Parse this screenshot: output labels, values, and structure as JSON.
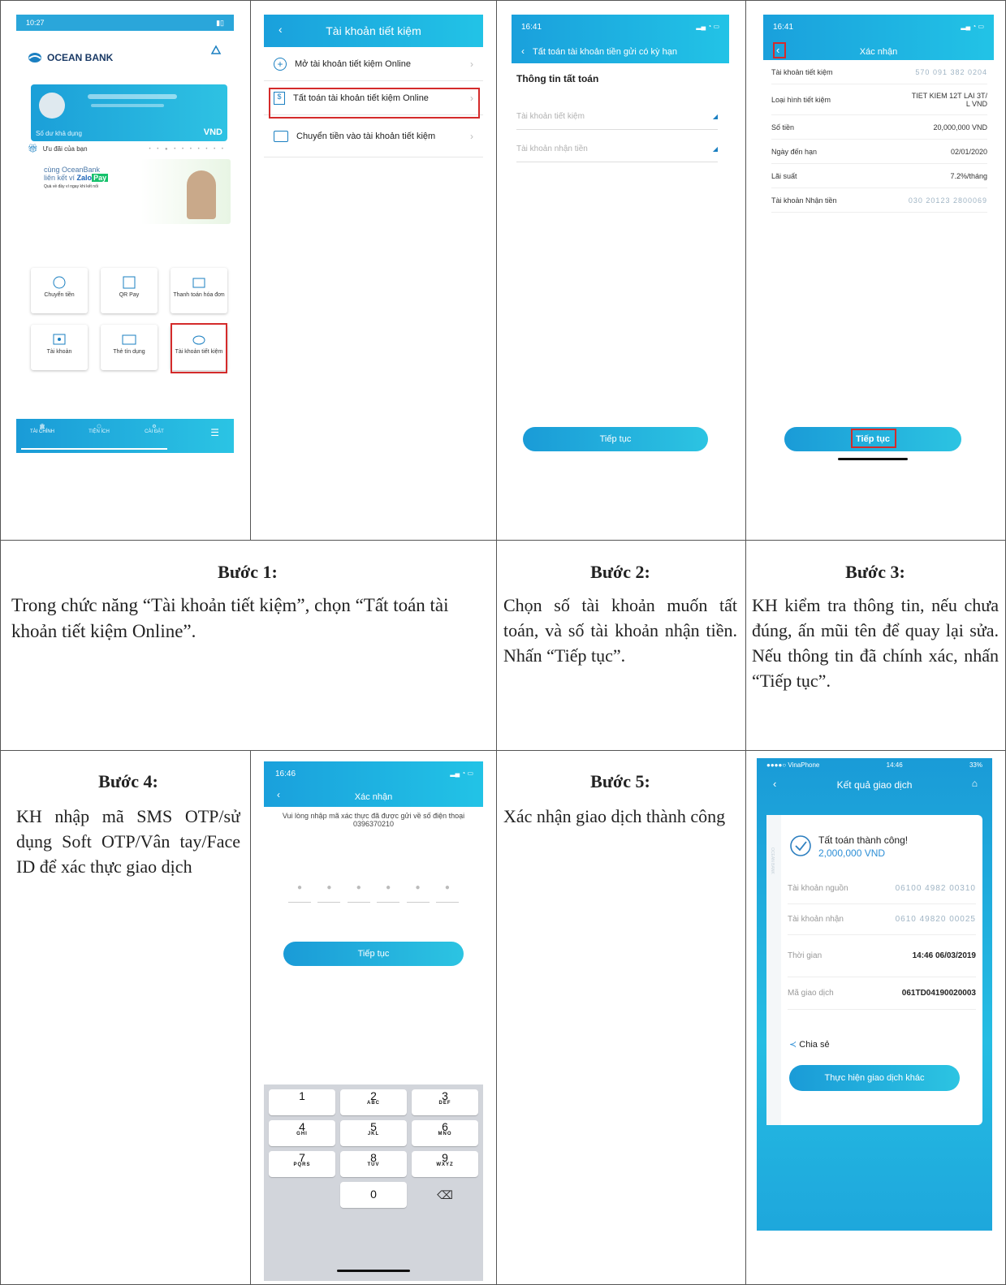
{
  "steps": {
    "s1": {
      "title": "Bước 1:",
      "text": "Trong chức năng “Tài khoản tiết kiệm”, chọn “Tất toán tài khoản tiết kiệm Online”."
    },
    "s2": {
      "title": "Bước 2:",
      "text": "Chọn số tài khoản muốn tất toán, và số tài khoản nhận tiền. Nhấn “Tiếp tục”."
    },
    "s3": {
      "title": "Bước 3:",
      "text": "KH kiểm tra thông tin, nếu chưa đúng, ấn mũi tên để quay lại sửa. Nếu thông tin đã chính xác, nhấn “Tiếp tục”."
    },
    "s4": {
      "title": "Bước 4:",
      "text": "KH nhập mã SMS OTP/sử dụng Soft OTP/Vân tay/Face ID để xác thực giao dịch"
    },
    "s5": {
      "title": "Bước 5:",
      "text": "Xác nhận giao dịch thành công"
    }
  },
  "screen1": {
    "time": "10:27",
    "brand": "OCEAN BANK",
    "balance_label": "Số dư khả dụng",
    "currency": "VND",
    "promo_label": "Ưu đãi của bạn",
    "promo_line1": "cùng OceanBank",
    "promo_line2": "liên kết ví",
    "promo_zalo": "Zalo",
    "promo_pay": "Pay",
    "promo_line3": "Quà về đầy ví ngay khi kết nối",
    "tiles": [
      "Chuyển tiền",
      "QR Pay",
      "Thanh toán hóa đơn",
      "Tài khoản",
      "Thẻ tín dụng",
      "Tài khoản tiết kiệm"
    ],
    "nav": [
      "TÀI CHÍNH",
      "TIỆN ÍCH",
      "CÀI ĐẶT"
    ]
  },
  "screen2": {
    "title": "Tài khoản tiết kiệm",
    "items": [
      "Mở tài khoản tiết kiệm Online",
      "Tất toán tài khoản tiết kiệm Online",
      "Chuyển tiền vào tài khoản tiết kiệm"
    ]
  },
  "screen3": {
    "time": "16:41",
    "title": "Tất toán tài khoản tiền gửi có kỳ hạn",
    "section": "Thông tin tất toán",
    "field1": "Tài khoản tiết kiệm",
    "field2": "Tài khoản nhận tiền",
    "button": "Tiếp tục"
  },
  "screen4": {
    "time": "16:41",
    "title": "Xác nhận",
    "rows": [
      {
        "label": "Tài khoản tiết kiệm",
        "value": "57⁠0 0⁠91 3⁠82 0⁠204"
      },
      {
        "label": "Loại hình tiết kiệm",
        "value": "TIET KIEM 12T LAI 3T/ L VND"
      },
      {
        "label": "Số tiền",
        "value": "20,000,000 VND"
      },
      {
        "label": "Ngày đến hạn",
        "value": "02/01/2020"
      },
      {
        "label": "Lãi suất",
        "value": "7.2%/tháng"
      },
      {
        "label": "Tài khoản Nhận tiền",
        "value": "030 20123 2800069"
      }
    ],
    "button": "Tiếp tục"
  },
  "screen5": {
    "time": "16:46",
    "title": "Xác nhận",
    "prompt": "Vui lòng nhập mã xác thực đã được gửi về số điện thoại 0396370210",
    "button": "Tiếp tục",
    "keys": [
      {
        "n": "1",
        "l": ""
      },
      {
        "n": "2",
        "l": "ABC"
      },
      {
        "n": "3",
        "l": "DEF"
      },
      {
        "n": "4",
        "l": "GHI"
      },
      {
        "n": "5",
        "l": "JKL"
      },
      {
        "n": "6",
        "l": "MNO"
      },
      {
        "n": "7",
        "l": "PQRS"
      },
      {
        "n": "8",
        "l": "TUV"
      },
      {
        "n": "9",
        "l": "WXYZ"
      },
      {
        "n": "0",
        "l": ""
      }
    ]
  },
  "screen6": {
    "carrier": "●●●●○ VinaPhone",
    "time": "14:46",
    "battery": "33%",
    "title": "Kết quả giao dịch",
    "success": "Tất toán thành công!",
    "amount": "2,000,000 VND",
    "rows": [
      {
        "label": "Tài khoản nguồn",
        "value": "06100 4982 00310"
      },
      {
        "label": "Tài khoản nhận",
        "value": "0610 49820 00025"
      },
      {
        "label": "Thời gian",
        "value": "14:46 06/03/2019"
      },
      {
        "label": "Mã giao dịch",
        "value": "061TD04190020003"
      }
    ],
    "share": "Chia sẻ",
    "button": "Thực hiện giao dịch khác",
    "side_brand": "OCEAN BANK"
  }
}
